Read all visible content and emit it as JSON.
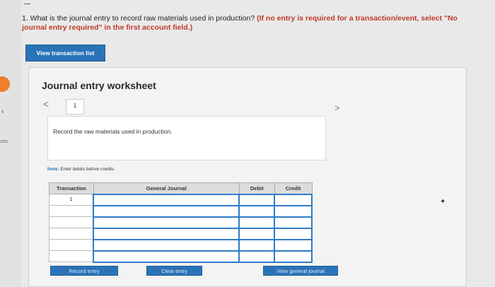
{
  "sidebar": {
    "partial_text": "ces"
  },
  "header": {
    "fragment": "—"
  },
  "question": {
    "text": "1. What is the journal entry to record raw materials used in production?",
    "emphasis": "(If no entry is required for a transaction/event, select \"No journal entry required\" in the first account field.)"
  },
  "buttons": {
    "view_transaction_list": "View transaction list",
    "record_entry": "Record entry",
    "clear_entry": "Clear entry",
    "view_general_journal": "View general journal"
  },
  "worksheet": {
    "title": "Journal entry worksheet",
    "page_number": "1",
    "instruction": "Record the raw materials used in production.",
    "note_label": "Note:",
    "note_text": "Enter debits before credits."
  },
  "table": {
    "headers": {
      "transaction": "Transaction",
      "general_journal": "General Journal",
      "debit": "Debit",
      "credit": "Credit"
    },
    "rows": [
      {
        "transaction": "1"
      },
      {
        "transaction": ""
      },
      {
        "transaction": ""
      },
      {
        "transaction": ""
      },
      {
        "transaction": ""
      },
      {
        "transaction": ""
      }
    ]
  },
  "colors": {
    "accent": "#2a73b8",
    "emphasis": "#c0392b",
    "tab_marker": "#ee7f2d"
  }
}
